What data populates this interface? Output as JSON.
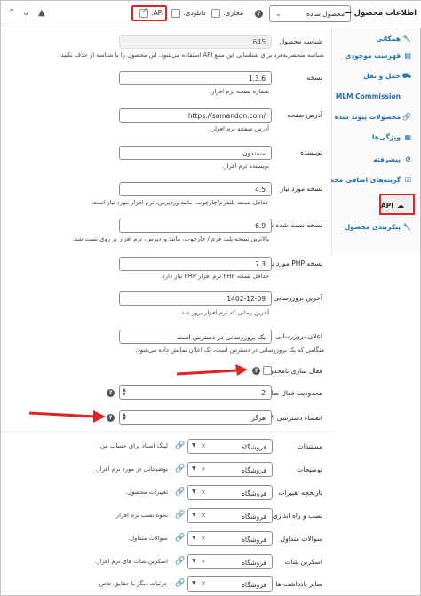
{
  "header": {
    "title": "اطلاعات محصول —",
    "product_type": "محصول ساده",
    "virtual_label": "مجازی:",
    "downloadable_label": "دانلودی:",
    "api_label": "API:"
  },
  "tabs": [
    {
      "label": "همگانی",
      "icon": "wrench-icon"
    },
    {
      "label": "فهرست موجودی",
      "icon": "clipboard-icon"
    },
    {
      "label": "حمل و نقل",
      "icon": "truck-icon"
    },
    {
      "label": "MLM Commission",
      "icon": "blank"
    },
    {
      "label": "محصولات پیوند شده",
      "icon": "link-icon"
    },
    {
      "label": "ویژگی‌ها",
      "icon": "grid-icon"
    },
    {
      "label": "پیشرفته",
      "icon": "gear-icon"
    },
    {
      "label": "گزینه‌های اضافی محصول",
      "icon": "checkbox-icon"
    },
    {
      "label": "API",
      "icon": "cloud-icon"
    },
    {
      "label": "پیکربندی محصول",
      "icon": "wrench-icon"
    }
  ],
  "fields": {
    "product_id": {
      "label": "شناسه محصول",
      "value": "645",
      "desc": "شناسه منحصربه‌فرد برای شناسایی این منبع API استفاده می‌شود. این محصول را با شناسه از حذف نکنید."
    },
    "version": {
      "label": "نسخه",
      "value": "1.3.6",
      "desc": "شماره نسخه نرم افزار."
    },
    "page_url": {
      "label": "آدرس صفحه",
      "value": "https://samandon.com/",
      "desc": "آدرس صفحه نرم افزار."
    },
    "author": {
      "label": "نویسنده",
      "value": "سمندون",
      "desc": "نویسنده نرم افزار."
    },
    "required_version": {
      "label": "نسخه مورد نیاز",
      "value": "4.5",
      "desc": "حداقل نسخه پلتفرم/چارچوب، مانند وردپرس، نرم افزار مورد نیاز است."
    },
    "tested_version": {
      "label": "نسخه تست شده تا",
      "value": "6.9",
      "desc": "بالاترین نسخه پلت فرم / چارچوب، مانند وردپرس، نرم افزار بر روی تست شد."
    },
    "php_version": {
      "label": "نسخه PHP مورد نیاز",
      "value": "7.3",
      "desc": "حداقل نسخه PHP نرم افزار PHP نیاز دارد."
    },
    "last_updated": {
      "label": "آخرین بروزرسانی",
      "value": "1402-12-09",
      "desc": "آخرین زمانی که نرم افزار بروز شد."
    },
    "update_notice": {
      "label": "اعلان بروزرسانی",
      "value": "یک بروزرسانی در دسترس است",
      "desc": "هنگامی که یک بروزرسانی در دسترس است، یک اعلان نمایش داده می‌شود."
    },
    "unlimited_activation": {
      "label": "فعال سازی نامحدود"
    },
    "activation_limit": {
      "label": "محدودیت فعال سازی",
      "value": "2"
    },
    "api_expiry": {
      "label": "انقضاء دسترسی API",
      "value": "هرگز"
    }
  },
  "doc_rows": [
    {
      "label": "مستندات",
      "select": "فروشگاه",
      "desc": "لینک اسناد برای حساب من."
    },
    {
      "label": "توضیحات",
      "select": "فروشگاه",
      "desc": "توضیحاتی در مورد نرم افزار."
    },
    {
      "label": "تاریخچه تغییرات",
      "select": "فروشگاه",
      "desc": "تغییرات محصول."
    },
    {
      "label": "نصب و راه اندازی",
      "select": "فروشگاه",
      "desc": "نحوه نصب نرم افزار."
    },
    {
      "label": "سوالات متداول",
      "select": "فروشگاه",
      "desc": "سوالات متداول."
    },
    {
      "label": "اسکرین شات",
      "select": "فروشگاه",
      "desc": "اسکرین شات های نرم افزار."
    },
    {
      "label": "سایر یادداشت ها",
      "select": "فروشگاه",
      "desc": "جزئیات دیگر یا حقایق خاص."
    }
  ],
  "colors": {
    "link": "#2271b1",
    "callout": "#e02424"
  }
}
